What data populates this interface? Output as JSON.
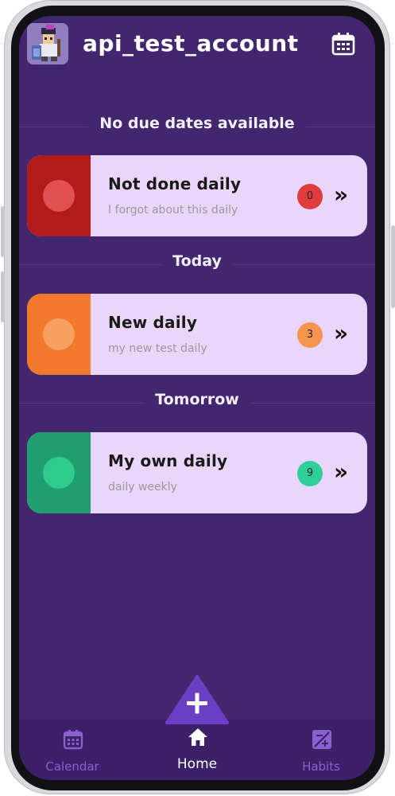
{
  "header": {
    "account_name": "api_test_account",
    "calendar_icon": "calendar-icon"
  },
  "sections": [
    {
      "title": "No due dates available",
      "cards": [
        {
          "title": "Not done daily",
          "subtitle": "I forgot about this daily",
          "streak": "0",
          "stripe_color": "#b31a1a",
          "dot_color": "#e05050",
          "badge_color": "#e03c3c"
        }
      ]
    },
    {
      "title": "Today",
      "cards": [
        {
          "title": "New daily",
          "subtitle": "my new test daily",
          "streak": "3",
          "stripe_color": "#f27a2a",
          "dot_color": "#f7a060",
          "badge_color": "#f7944d"
        }
      ]
    },
    {
      "title": "Tomorrow",
      "cards": [
        {
          "title": "My own daily",
          "subtitle": "daily weekly",
          "streak": "9",
          "stripe_color": "#1f9e72",
          "dot_color": "#2fcc8e",
          "badge_color": "#2ed09a"
        }
      ]
    }
  ],
  "fab": {
    "icon": "plus-icon",
    "color": "#6b3fc4"
  },
  "bottom_nav": [
    {
      "label": "Calendar",
      "icon": "calendar-icon",
      "active": false
    },
    {
      "label": "Home",
      "icon": "home-icon",
      "active": true
    },
    {
      "label": "Habits",
      "icon": "habits-icon",
      "active": false
    }
  ],
  "colors": {
    "background": "#42266e",
    "card": "#ead5fb",
    "nav_background": "#3d2168",
    "nav_inactive": "#8a5fd0"
  },
  "card_chevron": "»"
}
